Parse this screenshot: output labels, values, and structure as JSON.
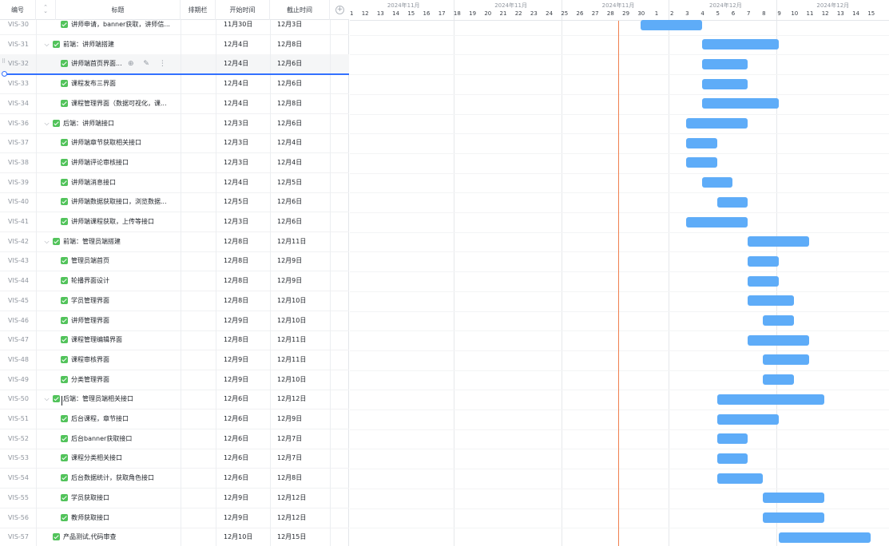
{
  "header": {
    "id": "编号",
    "title": "标题",
    "schedule": "排期栏",
    "start": "开始时间",
    "end": "截止时间"
  },
  "timeline": {
    "months": [
      {
        "label": "2024年11月",
        "start_index": 0,
        "span": 7
      },
      {
        "label": "2024年11月",
        "start_index": 7,
        "span": 7
      },
      {
        "label": "2024年11月",
        "start_index": 14,
        "span": 7
      },
      {
        "label": "2024年12月",
        "start_index": 21,
        "span": 7
      },
      {
        "label": "2024年12月",
        "start_index": 28,
        "span": 7
      }
    ],
    "days": [
      "11",
      "12",
      "13",
      "14",
      "15",
      "16",
      "17",
      "18",
      "19",
      "20",
      "21",
      "22",
      "23",
      "24",
      "25",
      "26",
      "27",
      "28",
      "29",
      "30",
      "1",
      "2",
      "3",
      "4",
      "5",
      "6",
      "7",
      "8",
      "9",
      "10",
      "11",
      "12",
      "13",
      "14",
      "15"
    ],
    "today_index": 17.5
  },
  "tasks": [
    {
      "id": "VIS-30",
      "title": "讲师申请，banner获取，讲师信...",
      "start": "11月30日",
      "end": "12月3日",
      "level": 1,
      "bar": [
        19,
        23
      ]
    },
    {
      "id": "VIS-31",
      "title": "前端：讲师端搭建",
      "start": "12月4日",
      "end": "12月8日",
      "level": 0,
      "group": true,
      "bar": [
        23,
        28
      ]
    },
    {
      "id": "VIS-32",
      "title": "讲师端首页界面...",
      "start": "12月4日",
      "end": "12月6日",
      "level": 1,
      "hover": true,
      "bar": [
        23,
        26
      ]
    },
    {
      "id": "VIS-33",
      "title": "课程发布三界面",
      "start": "12月4日",
      "end": "12月6日",
      "level": 1,
      "bar": [
        23,
        26
      ]
    },
    {
      "id": "VIS-34",
      "title": "课程管理界面（数据可视化，课...",
      "start": "12月4日",
      "end": "12月8日",
      "level": 1,
      "bar": [
        23,
        28
      ]
    },
    {
      "id": "VIS-36",
      "title": "后端：讲师端接口",
      "start": "12月3日",
      "end": "12月6日",
      "level": 0,
      "group": true,
      "bar": [
        22,
        26
      ]
    },
    {
      "id": "VIS-37",
      "title": "讲师端章节获取相关接口",
      "start": "12月3日",
      "end": "12月4日",
      "level": 1,
      "bar": [
        22,
        24
      ]
    },
    {
      "id": "VIS-38",
      "title": "讲师端评论审核接口",
      "start": "12月3日",
      "end": "12月4日",
      "level": 1,
      "bar": [
        22,
        24
      ]
    },
    {
      "id": "VIS-39",
      "title": "讲师端消息接口",
      "start": "12月4日",
      "end": "12月5日",
      "level": 1,
      "bar": [
        23,
        25
      ]
    },
    {
      "id": "VIS-40",
      "title": "讲师端数据获取接口，浏览数据...",
      "start": "12月5日",
      "end": "12月6日",
      "level": 1,
      "bar": [
        24,
        26
      ]
    },
    {
      "id": "VIS-41",
      "title": "讲师端课程获取，上传等接口",
      "start": "12月3日",
      "end": "12月6日",
      "level": 1,
      "bar": [
        22,
        26
      ]
    },
    {
      "id": "VIS-42",
      "title": "前端：管理员端搭建",
      "start": "12月8日",
      "end": "12月11日",
      "level": 0,
      "group": true,
      "bar": [
        26,
        30
      ]
    },
    {
      "id": "VIS-43",
      "title": "管理员端首页",
      "start": "12月8日",
      "end": "12月9日",
      "level": 1,
      "bar": [
        26,
        28
      ]
    },
    {
      "id": "VIS-44",
      "title": "轮播界面设计",
      "start": "12月8日",
      "end": "12月9日",
      "level": 1,
      "bar": [
        26,
        28
      ]
    },
    {
      "id": "VIS-45",
      "title": "学员管理界面",
      "start": "12月8日",
      "end": "12月10日",
      "level": 1,
      "bar": [
        26,
        29
      ]
    },
    {
      "id": "VIS-46",
      "title": "讲师管理界面",
      "start": "12月9日",
      "end": "12月10日",
      "level": 1,
      "bar": [
        27,
        29
      ]
    },
    {
      "id": "VIS-47",
      "title": "课程管理编辑界面",
      "start": "12月8日",
      "end": "12月11日",
      "level": 1,
      "bar": [
        26,
        30
      ]
    },
    {
      "id": "VIS-48",
      "title": "课程审核界面",
      "start": "12月9日",
      "end": "12月11日",
      "level": 1,
      "bar": [
        27,
        30
      ]
    },
    {
      "id": "VIS-49",
      "title": "分类管理界面",
      "start": "12月9日",
      "end": "12月10日",
      "level": 1,
      "bar": [
        27,
        29
      ]
    },
    {
      "id": "VIS-50",
      "title": "后端：管理员端相关接口",
      "start": "12月6日",
      "end": "12月12日",
      "level": 0,
      "group": true,
      "bar": [
        24,
        31
      ]
    },
    {
      "id": "VIS-51",
      "title": "后台课程，章节接口",
      "start": "12月6日",
      "end": "12月9日",
      "level": 1,
      "bar": [
        24,
        28
      ]
    },
    {
      "id": "VIS-52",
      "title": "后台banner获取接口",
      "start": "12月6日",
      "end": "12月7日",
      "level": 1,
      "bar": [
        24,
        26
      ]
    },
    {
      "id": "VIS-53",
      "title": "课程分类相关接口",
      "start": "12月6日",
      "end": "12月7日",
      "level": 1,
      "bar": [
        24,
        26
      ]
    },
    {
      "id": "VIS-54",
      "title": "后台数据统计，获取角色接口",
      "start": "12月6日",
      "end": "12月8日",
      "level": 1,
      "bar": [
        24,
        27
      ]
    },
    {
      "id": "VIS-55",
      "title": "学员获取接口",
      "start": "12月9日",
      "end": "12月12日",
      "level": 1,
      "bar": [
        27,
        31
      ]
    },
    {
      "id": "VIS-56",
      "title": "教师获取接口",
      "start": "12月9日",
      "end": "12月12日",
      "level": 1,
      "bar": [
        27,
        31
      ]
    },
    {
      "id": "VIS-57",
      "title": "产品测试,代码审查",
      "start": "12月10日",
      "end": "12月15日",
      "level": 0,
      "bar": [
        28,
        34
      ]
    }
  ],
  "colors": {
    "bar": "#5eacf8",
    "today_line": "#f07f4f",
    "checkbox": "#52c35b",
    "insert_line": "#3370ff"
  }
}
